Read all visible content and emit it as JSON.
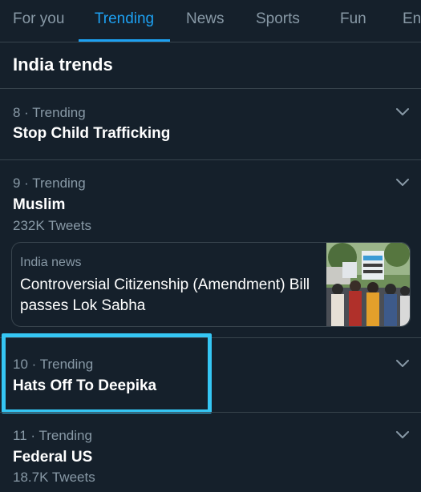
{
  "tabs": [
    {
      "label": "For you",
      "active": false
    },
    {
      "label": "Trending",
      "active": true
    },
    {
      "label": "News",
      "active": false
    },
    {
      "label": "Sports",
      "active": false
    },
    {
      "label": "Fun",
      "active": false
    },
    {
      "label": "En",
      "active": false
    }
  ],
  "section": {
    "title": "India trends"
  },
  "trends": [
    {
      "meta": "8 · Trending",
      "name": "Stop Child Trafficking",
      "count": ""
    },
    {
      "meta": "9 · Trending",
      "name": "Muslim",
      "count": "232K Tweets"
    },
    {
      "meta": "10 · Trending",
      "name": "Hats Off To Deepika",
      "count": ""
    },
    {
      "meta": "11 · Trending",
      "name": "Federal US",
      "count": "18.7K Tweets"
    }
  ],
  "news_card": {
    "source": "India news",
    "headline": "Controversial Citizenship (Amendment) Bill passes Lok Sabha"
  },
  "icons": {
    "chevron": "chevron-down-icon"
  },
  "colors": {
    "background": "#15202b",
    "accent": "#1da1f2",
    "secondary_text": "#8899a6",
    "divider": "#38444d",
    "highlight": "#35c6f4"
  }
}
